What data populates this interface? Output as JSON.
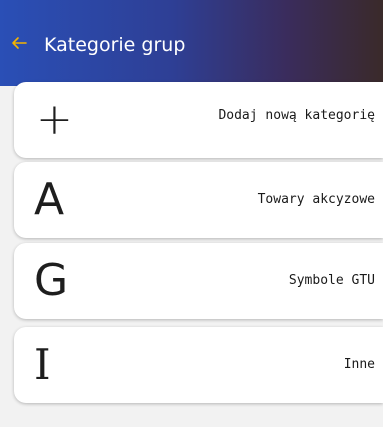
{
  "header": {
    "title": "Kategorie grup",
    "back_icon": "arrow-left-icon",
    "back_icon_color": "#f5b400",
    "gradient": [
      "#2a4fb6",
      "#3a2a2a"
    ]
  },
  "items": [
    {
      "glyph": "+",
      "label": "Dodaj nową kategorię"
    },
    {
      "glyph": "A",
      "label": "Towary akcyzowe"
    },
    {
      "glyph": "G",
      "label": "Symbole GTU"
    },
    {
      "glyph": "I",
      "label": "Inne"
    }
  ]
}
